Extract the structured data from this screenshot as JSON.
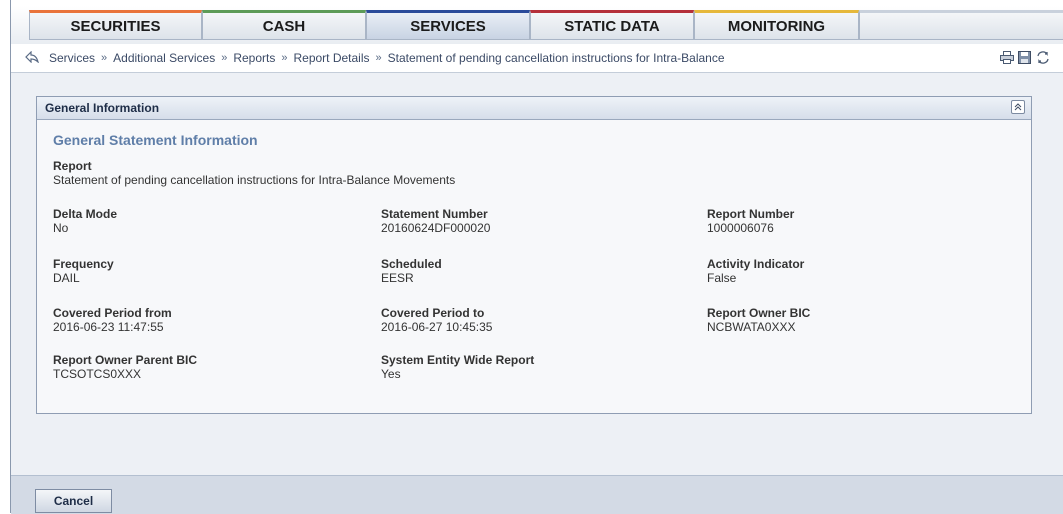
{
  "tabs": [
    {
      "label": "SECURITIES",
      "color": "#e9733a"
    },
    {
      "label": "CASH",
      "color": "#5d9b57"
    },
    {
      "label": "SERVICES",
      "color": "#2a4a9a"
    },
    {
      "label": "STATIC DATA",
      "color": "#b5303a"
    },
    {
      "label": "MONITORING",
      "color": "#e6b83a"
    }
  ],
  "active_tab": "SERVICES",
  "breadcrumb": {
    "items": [
      "Services",
      "Additional Services",
      "Reports",
      "Report Details",
      "Statement of pending cancellation instructions for Intra-Balance"
    ],
    "separator": "»"
  },
  "panel": {
    "title": "General Information",
    "section_title": "General Statement Information",
    "report": {
      "label": "Report",
      "value": "Statement of pending cancellation instructions for Intra-Balance Movements"
    },
    "fields": {
      "delta_mode": {
        "label": "Delta Mode",
        "value": "No"
      },
      "statement_number": {
        "label": "Statement Number",
        "value": "20160624DF000020"
      },
      "report_number": {
        "label": "Report Number",
        "value": "1000006076"
      },
      "frequency": {
        "label": "Frequency",
        "value": "DAIL"
      },
      "scheduled": {
        "label": "Scheduled",
        "value": "EESR"
      },
      "activity_indicator": {
        "label": "Activity Indicator",
        "value": "False"
      },
      "covered_from": {
        "label": "Covered Period from",
        "value": "2016-06-23 11:47:55"
      },
      "covered_to": {
        "label": "Covered Period to",
        "value": "2016-06-27 10:45:35"
      },
      "owner_bic": {
        "label": "Report Owner BIC",
        "value": "NCBWATA0XXX"
      },
      "owner_parent_bic": {
        "label": "Report Owner Parent BIC",
        "value": "TCSOTCS0XXX"
      },
      "system_wide": {
        "label": "System Entity Wide Report",
        "value": "Yes"
      }
    }
  },
  "buttons": {
    "cancel": "Cancel"
  },
  "icons": [
    "back-arrow-icon",
    "print-icon",
    "save-icon",
    "refresh-icon",
    "collapse-icon"
  ]
}
